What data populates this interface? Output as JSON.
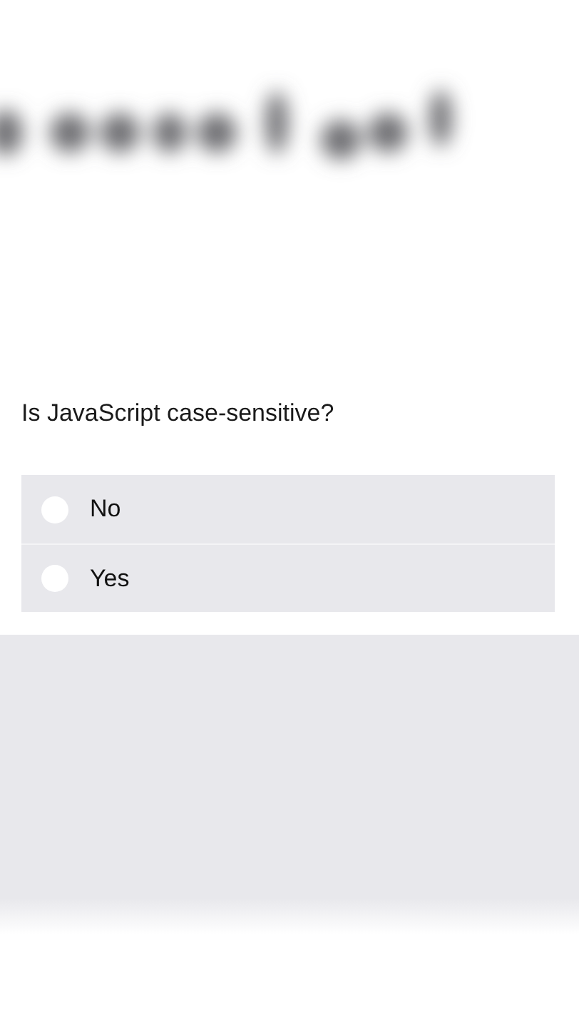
{
  "question": "Is JavaScript case-sensitive?",
  "options": [
    {
      "label": "No",
      "selected": false
    },
    {
      "label": "Yes",
      "selected": false
    }
  ]
}
